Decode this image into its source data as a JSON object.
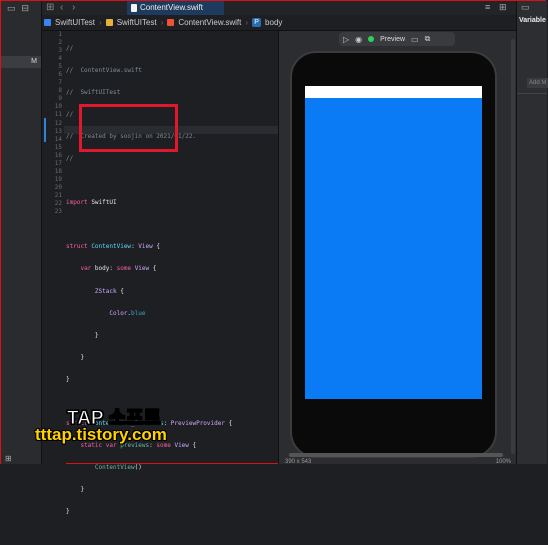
{
  "tab": {
    "filename": "ContentView.swift"
  },
  "jumpbar": {
    "project": "SwiftUITest",
    "group": "SwiftUITest",
    "file": "ContentView.swift",
    "symbol_badge": "P",
    "symbol": "body"
  },
  "left_panel": {
    "selected_label": "M"
  },
  "line_numbers": [
    "1",
    "2",
    "3",
    "4",
    "5",
    "6",
    "7",
    "8",
    "9",
    "10",
    "11",
    "12",
    "13",
    "14",
    "15",
    "16",
    "17",
    "18",
    "19",
    "20",
    "21",
    "22",
    "23"
  ],
  "code_lines": [
    "//",
    "//  ContentView.swift",
    "//  SwiftUITest",
    "//",
    "//  Created by soojin on 2021/01/22.",
    "//",
    "",
    "import SwiftUI",
    "",
    "struct ContentView: View {",
    "    var body: some View {",
    "        ZStack {",
    "            Color.blue",
    "        }",
    "    }",
    "}",
    "",
    "struct ContentView_Previews: PreviewProvider {",
    "    static var previews: some View {",
    "        ContentView()",
    "    }",
    "}",
    ""
  ],
  "canvas": {
    "preview_label": "Preview",
    "zoom": "100%",
    "size": "390 x 543"
  },
  "inspector": {
    "title": "Variable",
    "add_label": "Add M"
  },
  "watermark": {
    "line1": "TAP 소프트",
    "line2": "tttap.tistory.com"
  },
  "colors": {
    "preview_blue": "#0a7bf5",
    "accent_blue": "#2f83d4",
    "highlight_red": "#e0182b"
  }
}
